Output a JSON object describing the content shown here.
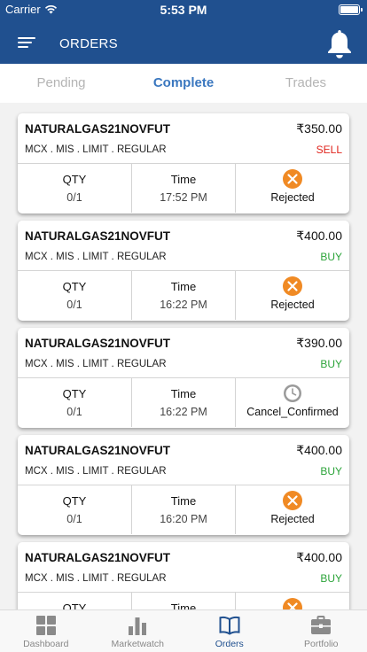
{
  "status_bar": {
    "carrier": "Carrier",
    "time": "5:53 PM",
    "battery_level": 1.0
  },
  "header": {
    "title": "ORDERS",
    "menu_icon": "hamburger-icon",
    "bell_icon": "bell-icon"
  },
  "tabs": [
    {
      "label": "Pending",
      "active": false
    },
    {
      "label": "Complete",
      "active": true
    },
    {
      "label": "Trades",
      "active": false
    }
  ],
  "labels": {
    "qty": "QTY",
    "time": "Time"
  },
  "orders": [
    {
      "symbol": "NATURALGAS21NOVFUT",
      "price": "₹350.00",
      "meta": "MCX . MIS . LIMIT . REGULAR",
      "side": "SELL",
      "qty": "0/1",
      "time": "17:52 PM",
      "status": "Rejected",
      "status_icon": "rejected-icon"
    },
    {
      "symbol": "NATURALGAS21NOVFUT",
      "price": "₹400.00",
      "meta": "MCX . MIS . LIMIT . REGULAR",
      "side": "BUY",
      "qty": "0/1",
      "time": "16:22 PM",
      "status": "Rejected",
      "status_icon": "rejected-icon"
    },
    {
      "symbol": "NATURALGAS21NOVFUT",
      "price": "₹390.00",
      "meta": "MCX . MIS . LIMIT . REGULAR",
      "side": "BUY",
      "qty": "0/1",
      "time": "16:22 PM",
      "status": "Cancel_Confirmed",
      "status_icon": "clock-icon"
    },
    {
      "symbol": "NATURALGAS21NOVFUT",
      "price": "₹400.00",
      "meta": "MCX . MIS . LIMIT . REGULAR",
      "side": "BUY",
      "qty": "0/1",
      "time": "16:20 PM",
      "status": "Rejected",
      "status_icon": "rejected-icon"
    },
    {
      "symbol": "NATURALGAS21NOVFUT",
      "price": "₹400.00",
      "meta": "MCX . MIS . LIMIT . REGULAR",
      "side": "BUY",
      "qty": "",
      "time": "",
      "status": "",
      "status_icon": "rejected-icon"
    }
  ],
  "tab_bar": [
    {
      "label": "Dashboard",
      "icon": "dashboard-icon",
      "active": false
    },
    {
      "label": "Marketwatch",
      "icon": "bar-chart-icon",
      "active": false
    },
    {
      "label": "Orders",
      "icon": "book-icon",
      "active": true
    },
    {
      "label": "Portfolio",
      "icon": "briefcase-icon",
      "active": false
    }
  ],
  "colors": {
    "primary": "#20508f",
    "tab_active": "#3a77bf",
    "sell": "#e0241c",
    "buy": "#2ca43a",
    "rejected": "#f08a24",
    "cancel": "#9a9a9a"
  }
}
